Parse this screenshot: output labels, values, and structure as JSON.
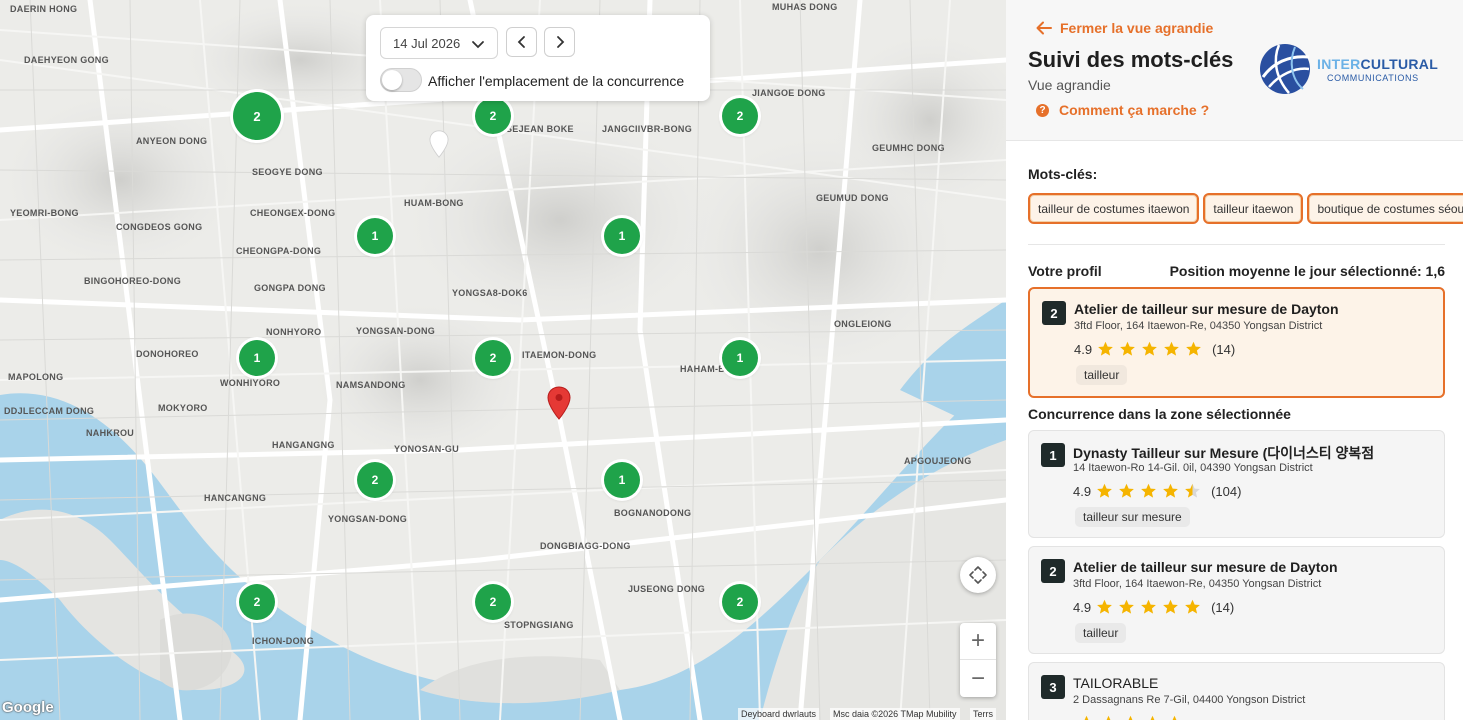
{
  "map": {
    "controls": {
      "date_value": "14 Jul 2026",
      "toggle_label": "Afficher l'emplacement de la concurrence"
    },
    "clusters": [
      {
        "count": "2",
        "size": "big"
      },
      {
        "count": "2",
        "size": "normal"
      },
      {
        "count": "2",
        "size": "normal"
      },
      {
        "count": "1",
        "size": "normal"
      },
      {
        "count": "1",
        "size": "normal"
      },
      {
        "count": "1",
        "size": "normal"
      },
      {
        "count": "2",
        "size": "normal"
      },
      {
        "count": "1",
        "size": "normal"
      },
      {
        "count": "2",
        "size": "normal"
      },
      {
        "count": "1",
        "size": "normal"
      },
      {
        "count": "2",
        "size": "normal"
      },
      {
        "count": "2",
        "size": "normal"
      },
      {
        "count": "2",
        "size": "normal"
      }
    ],
    "labels": [
      {
        "text": "DAERIN HONG",
        "kind": "main"
      },
      {
        "text": "DAEHYEON GONG",
        "kind": "main"
      },
      {
        "text": "ANYEON DONG",
        "kind": "main"
      },
      {
        "text": "SEOGYE DONG",
        "kind": "main"
      },
      {
        "text": "YEOMRI-BONG",
        "kind": "main"
      },
      {
        "text": "CONGDEOS GONG",
        "kind": "main"
      },
      {
        "text": "CHEONGEX-DONG",
        "kind": "main"
      },
      {
        "text": "CHEONGPA-DONG",
        "kind": "main"
      },
      {
        "text": "HUAM-BONG",
        "kind": "main"
      },
      {
        "text": "BINGOHOREO-DONG",
        "kind": "main"
      },
      {
        "text": "GONGPA DONG",
        "kind": "main"
      },
      {
        "text": "YONGSAN-DONG",
        "kind": "main"
      },
      {
        "text": "YONGSA8-DOK6",
        "kind": "main"
      },
      {
        "text": "DONOHOREO",
        "kind": "main"
      },
      {
        "text": "NONHYORO",
        "kind": "main"
      },
      {
        "text": "MAPOLONG",
        "kind": "main"
      },
      {
        "text": "WONHIYORO",
        "kind": "main"
      },
      {
        "text": "NAMSANDONG",
        "kind": "main"
      },
      {
        "text": "ITAEMON-DONG",
        "kind": "main"
      },
      {
        "text": "HAHAM-BON",
        "kind": "main"
      },
      {
        "text": "ONGLEIONG",
        "kind": "main"
      },
      {
        "text": "DDJLECCAM DONG",
        "kind": "main"
      },
      {
        "text": "MOKYORO",
        "kind": "main"
      },
      {
        "text": "NAHKROU",
        "kind": "main"
      },
      {
        "text": "HANGANGNG",
        "kind": "main"
      },
      {
        "text": "YONOSAN-GU",
        "kind": "main"
      },
      {
        "text": "APGOUJEONG",
        "kind": "main"
      },
      {
        "text": "HANCANGNG",
        "kind": "main"
      },
      {
        "text": "YONGSAN-DONG",
        "kind": "main"
      },
      {
        "text": "BOGNANODONG",
        "kind": "main"
      },
      {
        "text": "DONGBIAGG-DONG",
        "kind": "main"
      },
      {
        "text": "JUSEONG DONG",
        "kind": "main"
      },
      {
        "text": "STOPNGSIANG",
        "kind": "main"
      },
      {
        "text": "ICHON-DONG",
        "kind": "main"
      },
      {
        "text": "SEJEAN BOKE",
        "kind": "main"
      },
      {
        "text": "JANGCIIVBR-BONG",
        "kind": "main"
      },
      {
        "text": "JIANGOE DONG",
        "kind": "main"
      },
      {
        "text": "GEUMHC DONG",
        "kind": "main"
      },
      {
        "text": "GEUMUD DONG",
        "kind": "main"
      },
      {
        "text": "MUHAS DONG",
        "kind": "main"
      }
    ],
    "zoom_in": "+",
    "zoom_out": "−",
    "google_logo": "Google",
    "attribution": [
      "Deyboard dwrlauts",
      "Msc daia ©2026 TMap Mubility",
      "Terrs"
    ]
  },
  "sidebar": {
    "close_label": "Fermer la vue agrandie",
    "title": "Suivi des mots-clés",
    "subtitle": "Vue agrandie",
    "help_label": "Comment ça marche ?",
    "logo": {
      "part1": "INTER",
      "part2": "CULTURAL",
      "line2": "COMMUNICATIONS"
    },
    "keywords_title": "Mots-clés:",
    "keywords": [
      "tailleur de costumes itaewon",
      "tailleur itaewon",
      "boutique de costumes séoul"
    ],
    "profile_title": "Votre profil",
    "avg_position_label": "Position moyenne le jour sélectionné: 1,6",
    "profile": {
      "rank": "2",
      "name": "Atelier de tailleur sur mesure de Dayton",
      "address": "3ftd Floor, 164 Itaewon-Re, 04350 Yongsan District",
      "rating": "4.9",
      "stars": 5,
      "reviews": "(14)",
      "tag": "tailleur"
    },
    "competition_title": "Concurrence dans la zone sélectionnée",
    "competitors": [
      {
        "rank": "1",
        "name": "Dynasty Tailleur sur Mesure (다이너스티 양복점",
        "address": "14 Itaewon-Ro 14-Gil. 0il, 04390 Yongsan District",
        "rating": "4.9",
        "stars": 4.5,
        "reviews": "(104)",
        "tag": "tailleur sur mesure"
      },
      {
        "rank": "2",
        "name": "Atelier de tailleur sur mesure de Dayton",
        "address": "3ftd Floor, 164 Itaewon-Re, 04350 Yongsan District",
        "rating": "4.9",
        "stars": 5,
        "reviews": "(14)",
        "tag": "tailleur"
      },
      {
        "rank": "3",
        "name": "TAILORABLE",
        "address": "2 Dassagnans Re 7-Gil, 04400 Yongson District",
        "rating": "",
        "stars": 5,
        "reviews": "",
        "tag": ""
      }
    ],
    "colors": {
      "accent": "#e6702a",
      "star": "#f5b400",
      "cluster": "#1fa34a",
      "water": "#a9d3ea"
    }
  }
}
